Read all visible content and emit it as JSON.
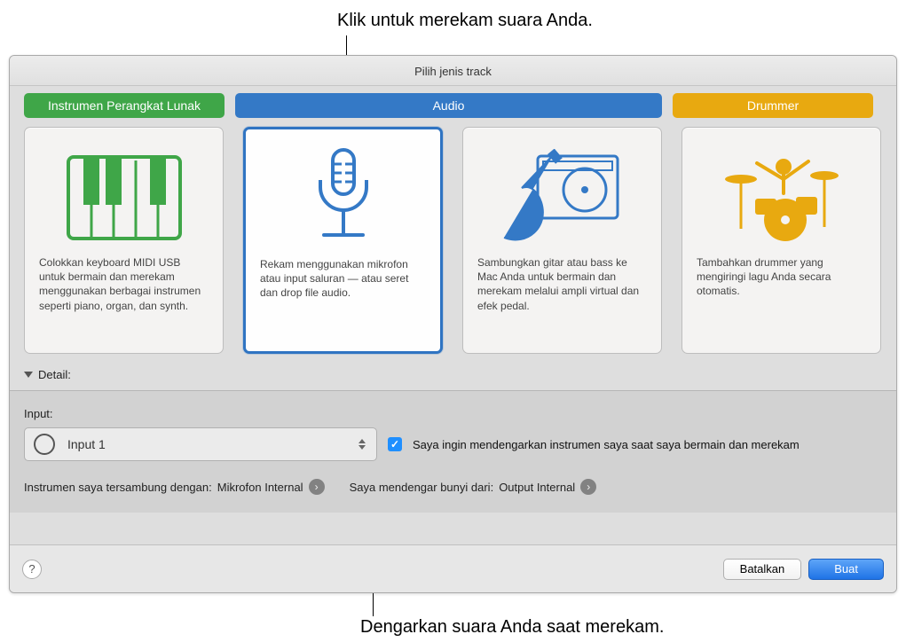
{
  "annotations": {
    "top": "Klik untuk merekam suara Anda.",
    "bottom": "Dengarkan suara Anda saat merekam."
  },
  "header": {
    "title": "Pilih jenis track"
  },
  "tabs": {
    "software": "Instrumen Perangkat Lunak",
    "audio": "Audio",
    "drummer": "Drummer"
  },
  "cards": {
    "software_desc": "Colokkan keyboard MIDI USB untuk bermain dan merekam menggunakan berbagai instrumen seperti piano, organ, dan synth.",
    "mic_desc": "Rekam menggunakan mikrofon atau input saluran — atau seret dan drop file audio.",
    "guitar_desc": "Sambungkan gitar atau bass ke Mac Anda untuk bermain dan merekam melalui ampli virtual dan efek pedal.",
    "drummer_desc": "Tambahkan drummer yang mengiringi lagu Anda secara otomatis."
  },
  "detail": {
    "label": "Detail:"
  },
  "input": {
    "label": "Input:",
    "value": "Input 1",
    "monitor_label": "Saya ingin mendengarkan instrumen saya saat saya bermain dan merekam",
    "connected_prefix": "Instrumen saya tersambung dengan: ",
    "connected_device": "Mikrofon Internal",
    "output_prefix": "Saya mendengar bunyi dari: ",
    "output_device": "Output Internal"
  },
  "footer": {
    "help": "?",
    "cancel": "Batalkan",
    "create": "Buat"
  },
  "colors": {
    "software": "#3fa648",
    "audio": "#3479c6",
    "drummer": "#e8a910",
    "highlight": "#2f74c2"
  }
}
